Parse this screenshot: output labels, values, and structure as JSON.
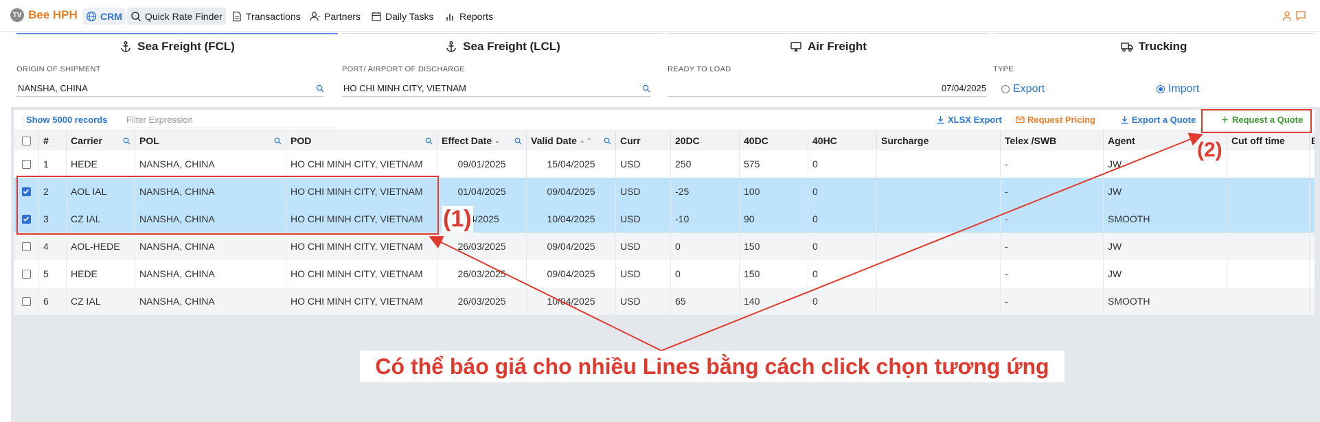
{
  "nav": {
    "brand_logo": "TV",
    "brand_name": "Bee HPH",
    "items": [
      "CRM",
      "Quick Rate Finder",
      "Transactions",
      "Partners",
      "Daily Tasks",
      "Reports"
    ]
  },
  "tabs": [
    "Sea Freight (FCL)",
    "Sea Freight (LCL)",
    "Air Freight",
    "Trucking"
  ],
  "form": {
    "origin": {
      "label": "ORIGIN OF SHIPMENT",
      "value": "NANSHA, CHINA"
    },
    "discharge": {
      "label": "PORT/ AIRPORT OF DISCHARGE",
      "value": "HO CHI MINH CITY, VIETNAM"
    },
    "ready": {
      "label": "READY TO LOAD",
      "value": "07/04/2025"
    },
    "type": {
      "label": "TYPE",
      "options": [
        "Export",
        "Import"
      ],
      "selected": "Import"
    }
  },
  "toolbar": {
    "show_records": "Show 5000 records",
    "filter_placeholder": "Filter Expression",
    "xlsx_export": "XLSX Export",
    "request_pricing": "Request Pricing",
    "export_quote": "Export a Quote",
    "request_quote": "Request a Quote"
  },
  "table": {
    "headers": [
      "#",
      "Carrier",
      "POL",
      "POD",
      "Effect Date",
      "Valid Date",
      "Curr",
      "20DC",
      "40DC",
      "40HC",
      "Surcharge",
      "Telex /SWB",
      "Agent",
      "Cut off time",
      "E"
    ],
    "rows": [
      {
        "num": "1",
        "carrier": "HEDE",
        "pol": "NANSHA, CHINA",
        "pod": "HO CHI MINH CITY, VIETNAM",
        "effect": "09/01/2025",
        "valid": "15/04/2025",
        "curr": "USD",
        "dc20": "250",
        "dc40": "575",
        "hc40": "0",
        "surcharge": "",
        "telex": "-",
        "agent": "JW",
        "cutoff": "",
        "checked": false
      },
      {
        "num": "2",
        "carrier": "AOL IAL",
        "pol": "NANSHA, CHINA",
        "pod": "HO CHI MINH CITY, VIETNAM",
        "effect": "01/04/2025",
        "valid": "09/04/2025",
        "curr": "USD",
        "dc20": "-25",
        "dc40": "100",
        "hc40": "0",
        "surcharge": "",
        "telex": "-",
        "agent": "JW",
        "cutoff": "",
        "checked": true
      },
      {
        "num": "3",
        "carrier": "CZ IAL",
        "pol": "NANSHA, CHINA",
        "pod": "HO CHI MINH CITY, VIETNAM",
        "effect": "04/2025",
        "valid": "10/04/2025",
        "curr": "USD",
        "dc20": "-10",
        "dc40": "90",
        "hc40": "0",
        "surcharge": "",
        "telex": "-",
        "agent": "SMOOTH",
        "cutoff": "",
        "checked": true
      },
      {
        "num": "4",
        "carrier": "AOL-HEDE",
        "pol": "NANSHA, CHINA",
        "pod": "HO CHI MINH CITY, VIETNAM",
        "effect": "26/03/2025",
        "valid": "09/04/2025",
        "curr": "USD",
        "dc20": "0",
        "dc40": "150",
        "hc40": "0",
        "surcharge": "",
        "telex": "-",
        "agent": "JW",
        "cutoff": "",
        "checked": false
      },
      {
        "num": "5",
        "carrier": "HEDE",
        "pol": "NANSHA, CHINA",
        "pod": "HO CHI MINH CITY, VIETNAM",
        "effect": "26/03/2025",
        "valid": "09/04/2025",
        "curr": "USD",
        "dc20": "0",
        "dc40": "150",
        "hc40": "0",
        "surcharge": "",
        "telex": "-",
        "agent": "JW",
        "cutoff": "",
        "checked": false
      },
      {
        "num": "6",
        "carrier": "CZ IAL",
        "pol": "NANSHA, CHINA",
        "pod": "HO CHI MINH CITY, VIETNAM",
        "effect": "26/03/2025",
        "valid": "10/04/2025",
        "curr": "USD",
        "dc20": "65",
        "dc40": "140",
        "hc40": "0",
        "surcharge": "",
        "telex": "-",
        "agent": "SMOOTH",
        "cutoff": "",
        "checked": false
      }
    ]
  },
  "annotations": {
    "label1": "(1)",
    "label2": "(2)",
    "caption": "Có thể báo giá cho nhiều Lines bằng cách click chọn tương ứng",
    "color": "#e03a2f"
  }
}
